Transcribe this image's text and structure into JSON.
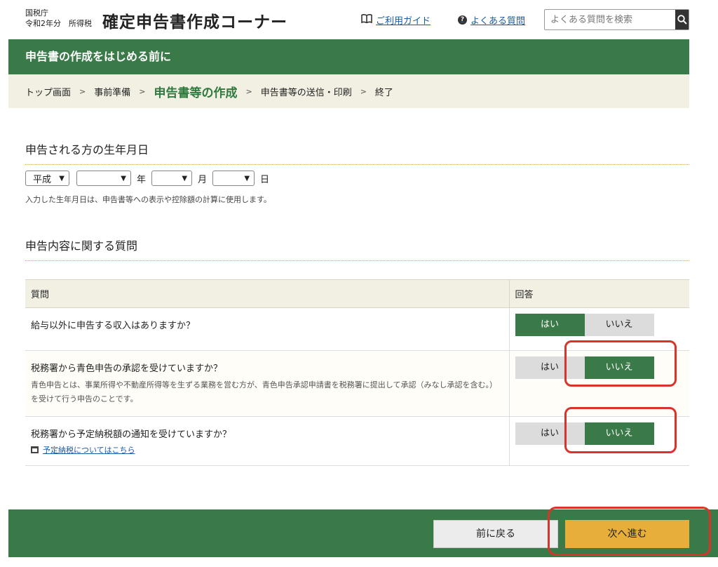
{
  "header": {
    "agency": "国税庁",
    "year_tax": "令和2年分　所得税",
    "title": "確定申告書作成コーナー",
    "guide_link": "ご利用ガイド",
    "faq_link": "よくある質問",
    "search_placeholder": "よくある質問を検索"
  },
  "banner": {
    "title": "申告書の作成をはじめる前に"
  },
  "steps": [
    "トップ画面",
    "事前準備",
    "申告書等の作成",
    "申告書等の送信・印刷",
    "終了"
  ],
  "birth": {
    "heading": "申告される方の生年月日",
    "era": "平成",
    "year_value": "",
    "month_value": "",
    "day_value": "",
    "year_unit": "年",
    "month_unit": "月",
    "day_unit": "日",
    "note": "入力した生年月日は、申告書等への表示や控除額の計算に使用します。"
  },
  "questions": {
    "heading": "申告内容に関する質問",
    "col_question": "質問",
    "col_answer": "回答",
    "yes": "はい",
    "no": "いいえ",
    "rows": [
      {
        "text": "給与以外に申告する収入はありますか？",
        "selected": "yes"
      },
      {
        "text": "税務署から青色申告の承認を受けていますか？",
        "note": "青色申告とは、事業所得や不動産所得等を生ずる業務を営む方が、青色申告承認申請書を税務署に提出して承認（みなし承認を含む。）を受けて行う申告のことです。",
        "selected": "no"
      },
      {
        "text": "税務署から予定納税額の通知を受けていますか？",
        "link": "予定納税についてはこちら",
        "selected": "no"
      }
    ]
  },
  "footer": {
    "back_label": "前に戻る",
    "next_label": "次へ進む"
  },
  "colors": {
    "accent_green": "#3a7a48",
    "next_button": "#e8ae3a",
    "annotation_red": "#d9342b"
  }
}
